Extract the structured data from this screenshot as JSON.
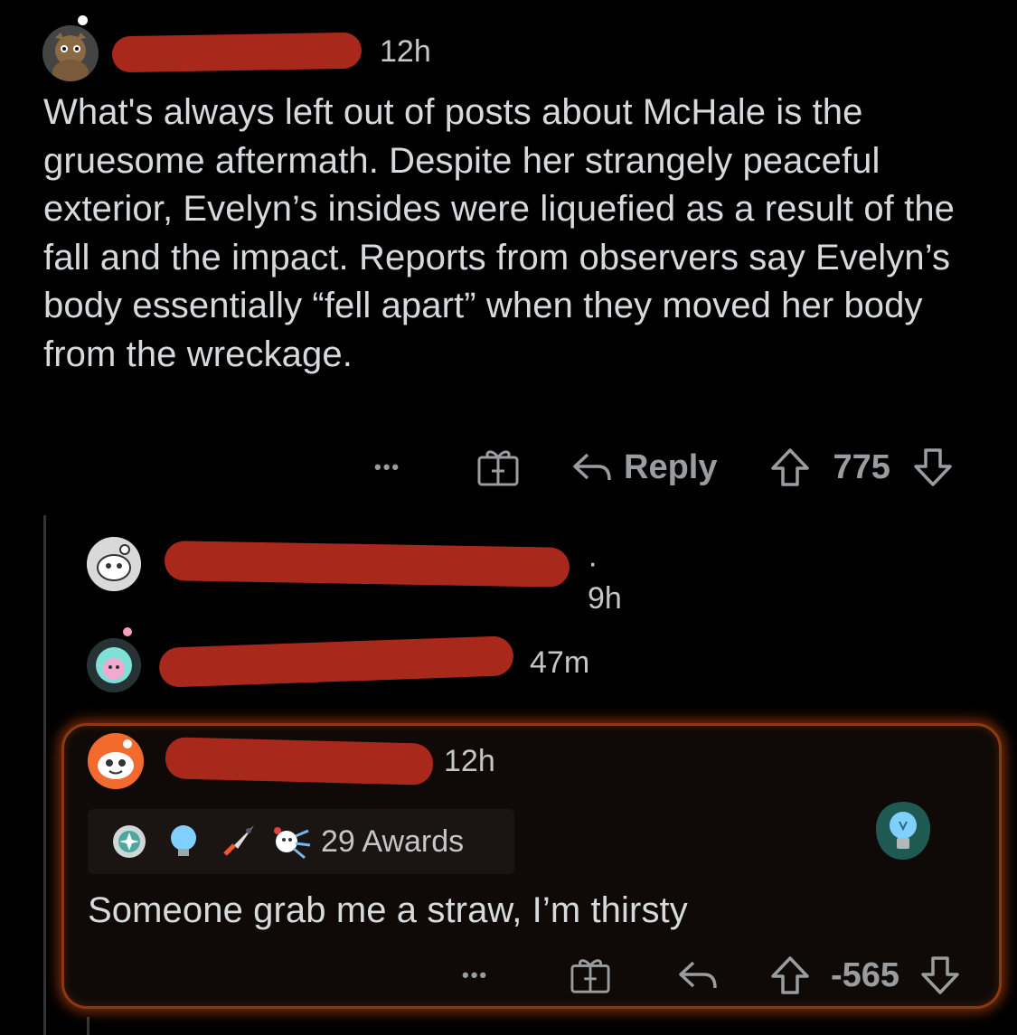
{
  "post": {
    "author_redacted": true,
    "time": "12h",
    "body": "What's always left out of posts about McHale is the gruesome aftermath. Despite her strangely peaceful exterior, Evelyn’s insides were liquefied as a result of the fall and the impact. Reports from observers say Evelyn’s body essentially “fell apart” when they moved her body from the wreckage.",
    "actions": {
      "more": "•••",
      "reply_label": "Reply",
      "score": "775"
    }
  },
  "replies": [
    {
      "time": "9h",
      "author_redacted": true
    },
    {
      "time": "47m",
      "author_redacted": true
    }
  ],
  "highlighted": {
    "time": "12h",
    "awards_label": "29 Awards",
    "body": "Someone grab me a straw, I’m thirsty",
    "actions": {
      "more": "•••",
      "score": "-565"
    }
  },
  "colors": {
    "background": "#000000",
    "text": "#d7dadc",
    "redaction": "#a8291b",
    "highlight_glow": "#e0521a",
    "lightbulb": "#7fd0ff"
  }
}
